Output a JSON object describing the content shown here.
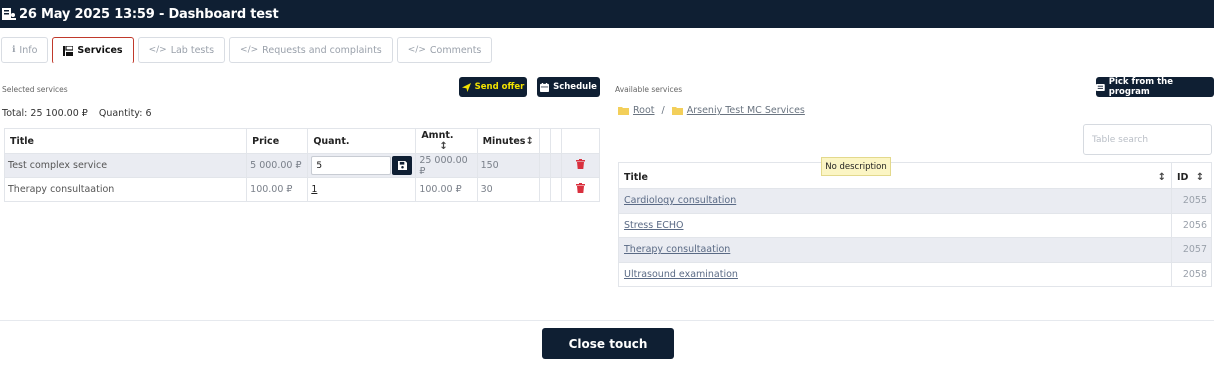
{
  "header": {
    "title": "26 May 2025 13:59 - Dashboard test",
    "icon": "user-card-icon"
  },
  "tabs": [
    {
      "label": "Info",
      "icon": "info-icon",
      "active": false
    },
    {
      "label": "Services",
      "icon": "layout-icon",
      "active": true
    },
    {
      "label": "Lab tests",
      "icon": "code-icon",
      "active": false
    },
    {
      "label": "Requests and complaints",
      "icon": "code-icon",
      "active": false
    },
    {
      "label": "Comments",
      "icon": "code-icon",
      "active": false
    }
  ],
  "selected": {
    "label": "Selected services",
    "total": "Total: 25 100.00 ₽",
    "quantity": "Quantity: 6",
    "send_offer": "Send offer",
    "schedule": "Schedule",
    "columns": {
      "title": "Title",
      "price": "Price",
      "quant": "Quant.",
      "amnt": "Amnt.",
      "minutes": "Minutes"
    },
    "rows": [
      {
        "title": "Test complex service",
        "price": "5 000.00 ₽",
        "qty": "5",
        "amount": "25 000.00 ₽",
        "minutes": "150"
      },
      {
        "title": "Therapy consultaation",
        "price": "100.00 ₽",
        "qty": "1",
        "amount": "100.00 ₽",
        "minutes": "30"
      }
    ]
  },
  "available": {
    "label": "Available services",
    "pick_button": "Pick from the program",
    "breadcrumb": [
      "Root",
      "Arseniy Test MC Services"
    ],
    "breadcrumb_sep": "/",
    "search_placeholder": "Table search",
    "tooltip": "No description",
    "columns": {
      "title": "Title",
      "id": "ID"
    },
    "rows": [
      {
        "title": "Cardiology consultation",
        "id": "2055"
      },
      {
        "title": "Stress ECHO",
        "id": "2056"
      },
      {
        "title": "Therapy consultaation",
        "id": "2057"
      },
      {
        "title": "Ultrasound examination",
        "id": "2058"
      }
    ]
  },
  "footer": {
    "close_label": "Close touch"
  },
  "colors": {
    "primary": "#0f1f33",
    "accent_yellow": "#f2e200",
    "delete_red": "#d9303e",
    "active_tab_border": "#c0392b",
    "row_alt": "#eaecf2"
  }
}
